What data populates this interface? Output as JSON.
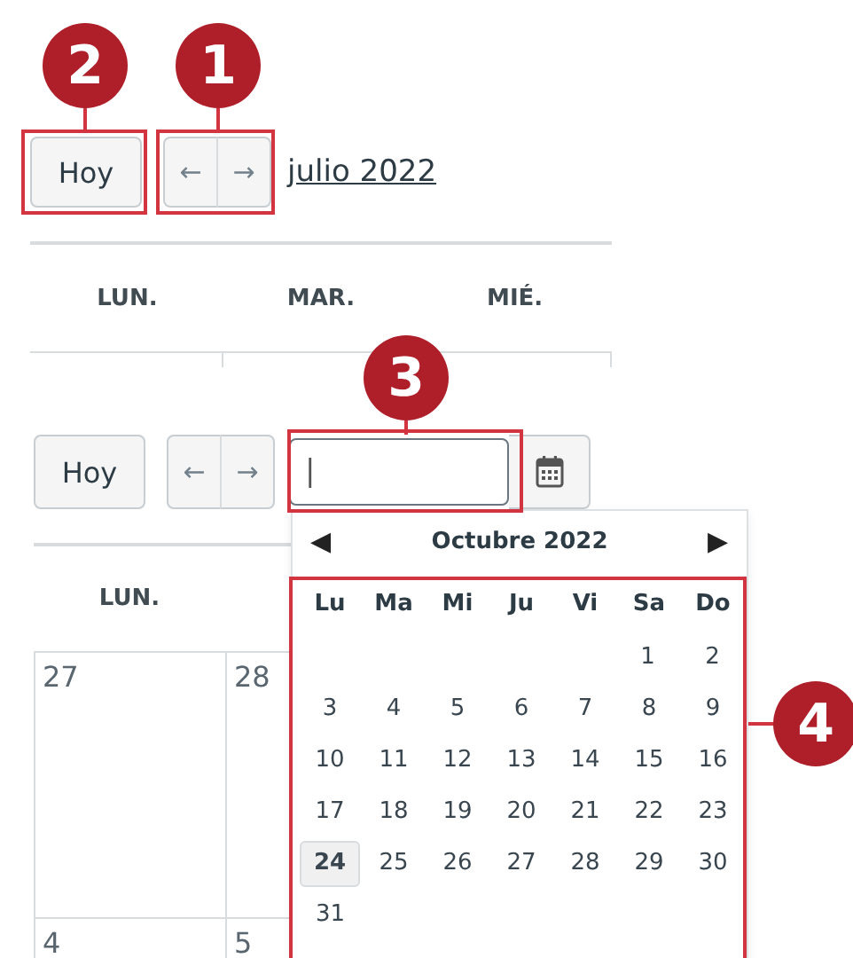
{
  "month_view": {
    "today_button": "Hoy",
    "prev_button": "←",
    "next_button": "→",
    "month_title": "julio 2022",
    "weekdays": [
      "LUN.",
      "MAR.",
      "MIÉ."
    ]
  },
  "week_view": {
    "today_button": "Hoy",
    "prev_button": "←",
    "next_button": "→",
    "date_input": {
      "value": "|"
    },
    "weekday": "LUN.",
    "cells": [
      "27",
      "28",
      "4",
      "5"
    ]
  },
  "date_picker": {
    "month": "Octubre 2022",
    "prev": "◀",
    "next": "▶",
    "weekdays": [
      "Lu",
      "Ma",
      "Mi",
      "Ju",
      "Vi",
      "Sa",
      "Do"
    ],
    "weeks": [
      [
        {
          "label": "1",
          "selected": false
        },
        {
          "label": "2",
          "selected": false
        }
      ],
      [
        {
          "label": "3",
          "selected": false
        },
        {
          "label": "4",
          "selected": false
        },
        {
          "label": "5",
          "selected": false
        },
        {
          "label": "6",
          "selected": false
        },
        {
          "label": "7",
          "selected": false
        },
        {
          "label": "8",
          "selected": false
        },
        {
          "label": "9",
          "selected": false
        }
      ],
      [
        {
          "label": "10",
          "selected": false
        },
        {
          "label": "11",
          "selected": false
        },
        {
          "label": "12",
          "selected": false
        },
        {
          "label": "13",
          "selected": false
        },
        {
          "label": "14",
          "selected": false
        },
        {
          "label": "15",
          "selected": false
        },
        {
          "label": "16",
          "selected": false
        }
      ],
      [
        {
          "label": "17",
          "selected": false
        },
        {
          "label": "18",
          "selected": false
        },
        {
          "label": "19",
          "selected": false
        },
        {
          "label": "20",
          "selected": false
        },
        {
          "label": "21",
          "selected": false
        },
        {
          "label": "22",
          "selected": false
        },
        {
          "label": "23",
          "selected": false
        }
      ],
      [
        {
          "label": "24",
          "selected": true
        },
        {
          "label": "25",
          "selected": false
        },
        {
          "label": "26",
          "selected": false
        },
        {
          "label": "27",
          "selected": false
        },
        {
          "label": "28",
          "selected": false
        },
        {
          "label": "29",
          "selected": false
        },
        {
          "label": "30",
          "selected": false
        }
      ],
      [
        {
          "label": "31",
          "selected": false
        }
      ]
    ]
  },
  "callouts": [
    {
      "number": "1"
    },
    {
      "number": "2"
    },
    {
      "number": "3"
    },
    {
      "number": "4"
    }
  ]
}
